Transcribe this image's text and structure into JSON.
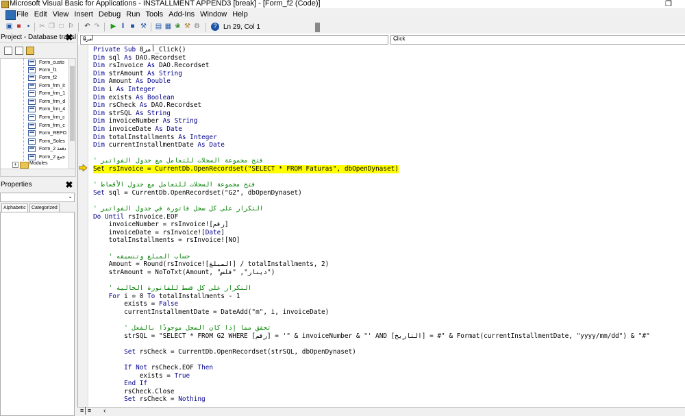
{
  "window": {
    "title": "Microsoft Visual Basic for Applications - INSTALLMENT APPEND3 [break] - [Form_f2 (Code)]"
  },
  "menu": [
    "File",
    "Edit",
    "View",
    "Insert",
    "Debug",
    "Run",
    "Tools",
    "Add-Ins",
    "Window",
    "Help"
  ],
  "toolbar": {
    "position": "Ln 29, Col 1"
  },
  "project": {
    "title": "Project - Database transl",
    "items": [
      "Form_custo",
      "Form_f1",
      "Form_f2",
      "Form_frm_it",
      "Form_frm_1",
      "Form_frm_d",
      "Form_frm_4",
      "Form_frm_c",
      "Form_frm_c",
      "Form_REPO",
      "Form_Soles",
      "Form_2 دفعة",
      "Form_2 جمع"
    ],
    "modules": "Modules"
  },
  "properties": {
    "title": "Properties",
    "tab_alphabetic": "Alphabetic",
    "tab_categorized": "Categorized"
  },
  "code_window": {
    "object": "أمر8",
    "procedure": "Click"
  },
  "code_lines": [
    {
      "text": "Private Sub أمر8_Click()",
      "type": "code"
    },
    {
      "text": "Dim sql As DAO.Recordset",
      "type": "code"
    },
    {
      "text": "Dim rsInvoice As DAO.Recordset",
      "type": "code"
    },
    {
      "text": "Dim strAmount As String",
      "type": "code"
    },
    {
      "text": "Dim Amount As Double",
      "type": "code"
    },
    {
      "text": "Dim i As Integer",
      "type": "code"
    },
    {
      "text": "Dim exists As Boolean",
      "type": "code"
    },
    {
      "text": "Dim rsCheck As DAO.Recordset",
      "type": "code"
    },
    {
      "text": "Dim strSQL As String",
      "type": "code"
    },
    {
      "text": "Dim invoiceNumber As String",
      "type": "code"
    },
    {
      "text": "Dim invoiceDate As Date",
      "type": "code"
    },
    {
      "text": "Dim totalInstallments As Integer",
      "type": "code"
    },
    {
      "text": "Dim currentInstallmentDate As Date",
      "type": "code"
    },
    {
      "text": "",
      "type": "code"
    },
    {
      "text": "' فتح مجموعة السجلات للتعامل مع جدول الفواتير",
      "type": "comment"
    },
    {
      "text": "Set rsInvoice = CurrentDb.OpenRecordset(\"SELECT * FROM Faturas\", dbOpenDynaset)",
      "type": "highlight"
    },
    {
      "text": "",
      "type": "code"
    },
    {
      "text": "' فتح مجموعة السجلات للتعامل مع جدول الأقساط",
      "type": "comment"
    },
    {
      "text": "Set sql = CurrentDb.OpenRecordset(\"G2\", dbOpenDynaset)",
      "type": "code"
    },
    {
      "text": "",
      "type": "code"
    },
    {
      "text": "' التكرار على كل سجل فاتورة في جدول الفواتير",
      "type": "comment"
    },
    {
      "text": "Do Until rsInvoice.EOF",
      "type": "code"
    },
    {
      "text": "    invoiceNumber = rsInvoice![رقم]",
      "type": "code"
    },
    {
      "text": "    invoiceDate = rsInvoice![Date]",
      "type": "code"
    },
    {
      "text": "    totalInstallments = rsInvoice![NO]",
      "type": "code"
    },
    {
      "text": "",
      "type": "code"
    },
    {
      "text": "    ' حساب المبلغ وتنسيقه",
      "type": "comment"
    },
    {
      "text": "    Amount = Round(rsInvoice![المبلغ] / totalInstallments, 2)",
      "type": "code"
    },
    {
      "text": "    strAmount = NoToTxt(Amount, \"دينار\", \"فلس\")",
      "type": "code"
    },
    {
      "text": "",
      "type": "code"
    },
    {
      "text": "    ' التكرار على كل قسط للفاتورة الحالية",
      "type": "comment"
    },
    {
      "text": "    For i = 0 To totalInstallments - 1",
      "type": "code"
    },
    {
      "text": "        exists = False",
      "type": "code"
    },
    {
      "text": "        currentInstallmentDate = DateAdd(\"m\", i, invoiceDate)",
      "type": "code"
    },
    {
      "text": "",
      "type": "code"
    },
    {
      "text": "        ' تحقق مما إذا كان السجل موجودًا بالفعل",
      "type": "comment"
    },
    {
      "text": "        strSQL = \"SELECT * FROM G2 WHERE [رقم] = '\" & invoiceNumber & \"' AND [التاريخ] = #\" & Format(currentInstallmentDate, \"yyyy/mm/dd\") & \"#\"",
      "type": "code"
    },
    {
      "text": "",
      "type": "code"
    },
    {
      "text": "        Set rsCheck = CurrentDb.OpenRecordset(strSQL, dbOpenDynaset)",
      "type": "code"
    },
    {
      "text": "",
      "type": "code"
    },
    {
      "text": "        If Not rsCheck.EOF Then",
      "type": "code"
    },
    {
      "text": "            exists = True",
      "type": "code"
    },
    {
      "text": "        End If",
      "type": "code"
    },
    {
      "text": "        rsCheck.Close",
      "type": "code"
    },
    {
      "text": "        Set rsCheck = Nothing",
      "type": "code"
    }
  ],
  "colors": {
    "keyword": "#00008b",
    "comment": "#008000",
    "highlight": "#ffff00",
    "arrow": "#f5d000"
  }
}
